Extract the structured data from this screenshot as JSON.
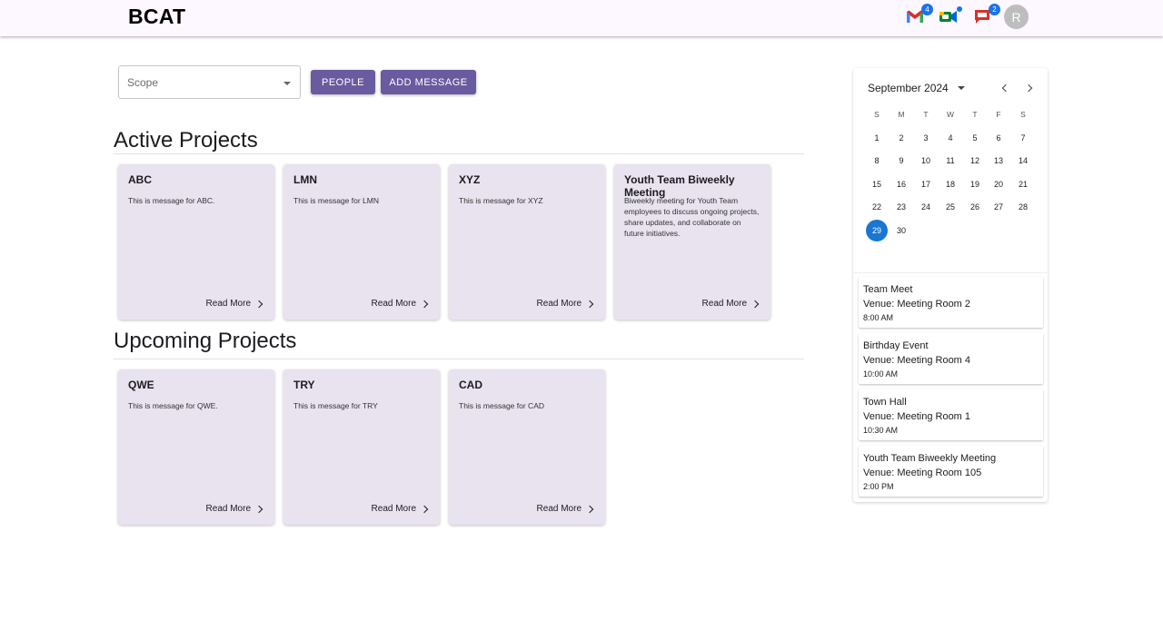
{
  "app": {
    "title": "BCAT"
  },
  "header": {
    "mail_badge": "4",
    "meet_badge": "",
    "chat_badge": "2",
    "avatar_initial": "R"
  },
  "controls": {
    "scope_label": "Scope",
    "people_button": "PEOPLE",
    "add_message_button": "ADD MESSAGE"
  },
  "active": {
    "title": "Active Projects",
    "cards": [
      {
        "title": "ABC",
        "message": "This is message for ABC.",
        "more": "Read More"
      },
      {
        "title": "LMN",
        "message": "This is message for LMN",
        "more": "Read More"
      },
      {
        "title": "XYZ",
        "message": "This is message for XYZ",
        "more": "Read More"
      },
      {
        "title": "Youth Team Biweekly Meeting",
        "message": "Biweekly meeting for Youth Team employees to discuss ongoing projects, share updates, and collaborate on future initiatives.",
        "more": "Read More"
      }
    ]
  },
  "upcoming": {
    "title": "Upcoming Projects",
    "cards": [
      {
        "title": "QWE",
        "message": "This is message for QWE.",
        "more": "Read More"
      },
      {
        "title": "TRY",
        "message": "This is message for TRY",
        "more": "Read More"
      },
      {
        "title": "CAD",
        "message": "This is message for CAD",
        "more": "Read More"
      }
    ]
  },
  "calendar": {
    "month_label": "September 2024",
    "weekdays": [
      "S",
      "M",
      "T",
      "W",
      "T",
      "F",
      "S"
    ],
    "days": [
      "1",
      "2",
      "3",
      "4",
      "5",
      "6",
      "7",
      "8",
      "9",
      "10",
      "11",
      "12",
      "13",
      "14",
      "15",
      "16",
      "17",
      "18",
      "19",
      "20",
      "21",
      "22",
      "23",
      "24",
      "25",
      "26",
      "27",
      "28",
      "29",
      "30"
    ],
    "selected_day": "29"
  },
  "events": [
    {
      "name": "Team Meet",
      "venue": "Venue: Meeting Room 2",
      "time": "8:00 AM"
    },
    {
      "name": "Birthday Event",
      "venue": "Venue: Meeting Room 4",
      "time": "10:00 AM"
    },
    {
      "name": "Town Hall",
      "venue": "Venue: Meeting Room 1",
      "time": "10:30 AM"
    },
    {
      "name": "Youth Team Biweekly Meeting",
      "venue": "Venue: Meeting Room 105",
      "time": "2:00 PM"
    }
  ]
}
